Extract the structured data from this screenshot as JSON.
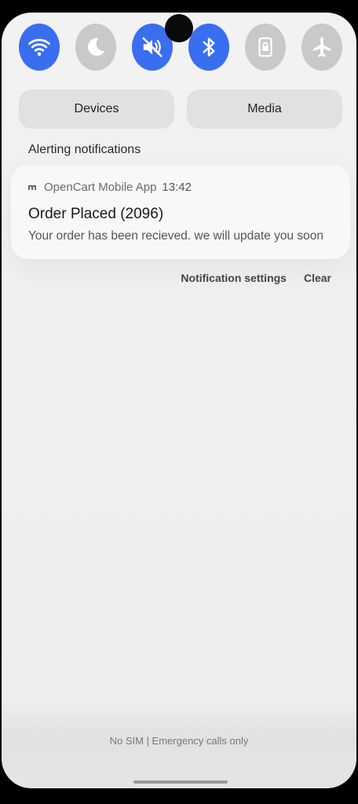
{
  "quick_settings": [
    {
      "id": "wifi",
      "icon": "wifi-icon",
      "state": "on"
    },
    {
      "id": "dnd",
      "icon": "moon-icon",
      "state": "off"
    },
    {
      "id": "sound",
      "icon": "mute-icon",
      "state": "on"
    },
    {
      "id": "bluetooth",
      "icon": "bluetooth-icon",
      "state": "on"
    },
    {
      "id": "rotation-lock",
      "icon": "lock-icon",
      "state": "off"
    },
    {
      "id": "airplane",
      "icon": "airplane-icon",
      "state": "off"
    }
  ],
  "pills": {
    "devices_label": "Devices",
    "media_label": "Media"
  },
  "section": {
    "label": "Alerting notifications"
  },
  "notification": {
    "app_name": "OpenCart Mobile App",
    "time": "13:42",
    "title": "Order Placed (2096)",
    "body": "Your order has been recieved. we will update you soon"
  },
  "actions": {
    "settings_label": "Notification settings",
    "clear_label": "Clear"
  },
  "status": {
    "text": "No SIM | Emergency calls only"
  },
  "colors": {
    "accent_on": "#3a6ef0",
    "tile_off": "#c9c9c9"
  }
}
